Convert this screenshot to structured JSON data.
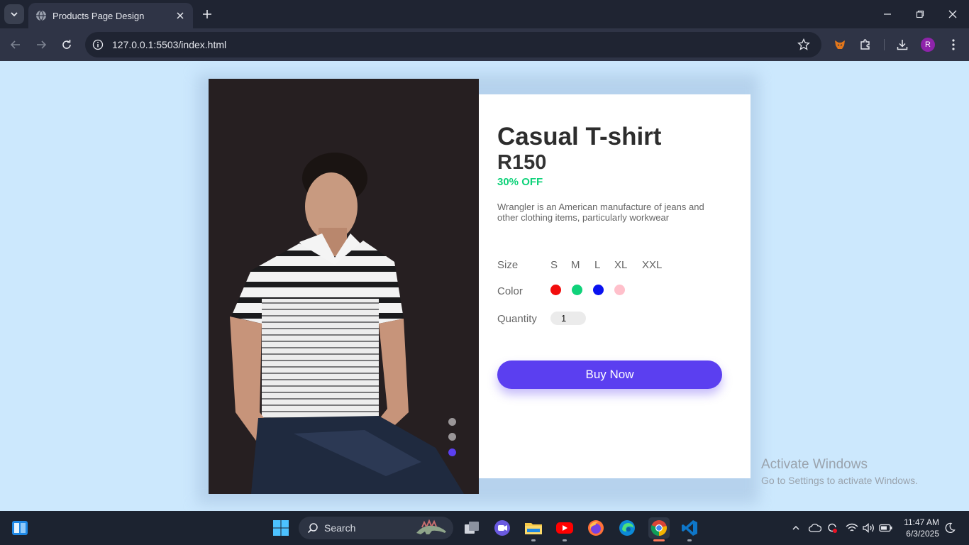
{
  "browser": {
    "tab_title": "Products Page Design",
    "url": "127.0.0.1:5503/index.html",
    "profile_initial": "R"
  },
  "product": {
    "title": "Casual T-shirt",
    "price": "R150",
    "discount": "30% OFF",
    "description": "Wrangler is an American manufacture of jeans and other clothing items, particularly workwear",
    "size_label": "Size",
    "sizes": [
      "S",
      "M",
      "L",
      "XL",
      "XXL"
    ],
    "color_label": "Color",
    "colors": [
      "#f20d0d",
      "#10d27a",
      "#0a12f0",
      "#ffc0cb"
    ],
    "quantity_label": "Quantity",
    "quantity": "1",
    "buy_label": "Buy Now",
    "active_slide": 3,
    "slide_count": 3,
    "accent_color": "#5b3ff0"
  },
  "watermark": {
    "line1": "Activate Windows",
    "line2": "Go to Settings to activate Windows."
  },
  "taskbar": {
    "search_label": "Search",
    "time": "11:47 AM",
    "date": "6/3/2025"
  }
}
